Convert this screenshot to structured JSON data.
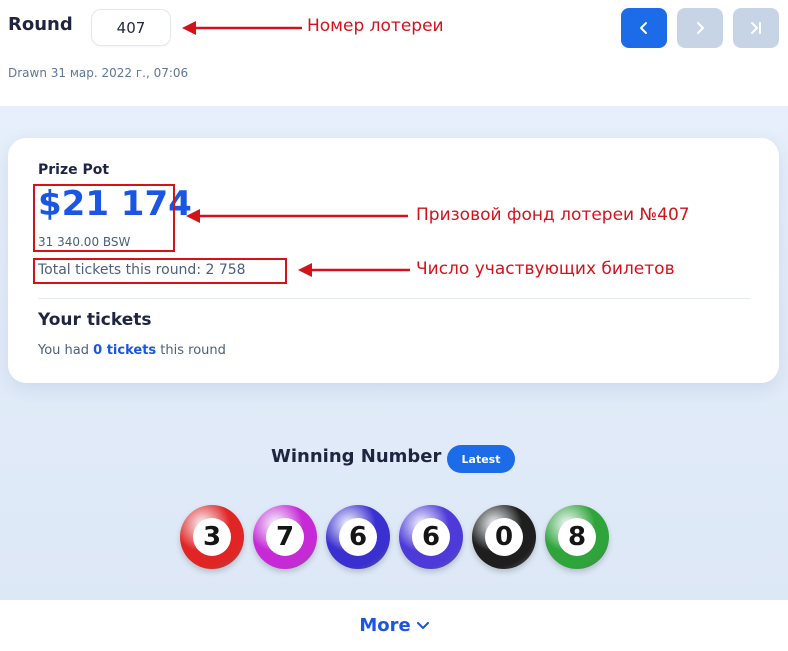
{
  "header": {
    "round_label": "Round",
    "round_value": "407",
    "drawn_text": "Drawn 31 мар. 2022 г., 07:06",
    "nav": {
      "prev_icon": "chevron-left-icon",
      "next_icon": "chevron-right-icon",
      "last_icon": "skip-to-last-icon"
    }
  },
  "annotations": {
    "round": "Номер лотереи",
    "prize": "Призовой фонд лотереи №407",
    "tickets": "Число участвующих билетов"
  },
  "card": {
    "prize_label": "Prize Pot",
    "prize_value": "$21 174",
    "prize_bsw": "31 340.00 BSW",
    "total_tickets": "Total tickets this round: 2 758",
    "your_tickets_title": "Your tickets",
    "you_had_prefix": "You had",
    "you_had_count": "0 tickets",
    "you_had_suffix": "this round"
  },
  "winning": {
    "title": "Winning Number",
    "badge": "Latest",
    "balls": [
      {
        "digit": "3",
        "color": "#e12525"
      },
      {
        "digit": "7",
        "color": "#c62ad6"
      },
      {
        "digit": "6",
        "color": "#3a2fd0"
      },
      {
        "digit": "6",
        "color": "#4d3ad8"
      },
      {
        "digit": "0",
        "color": "#1e1e1e"
      },
      {
        "digit": "8",
        "color": "#2fa43a"
      }
    ]
  },
  "footer": {
    "more_label": "More",
    "more_icon": "chevron-down-icon"
  },
  "colors": {
    "accent": "#1c6be8",
    "annotation_red": "#d4121a",
    "nav_disabled": "#c7d4e5"
  }
}
